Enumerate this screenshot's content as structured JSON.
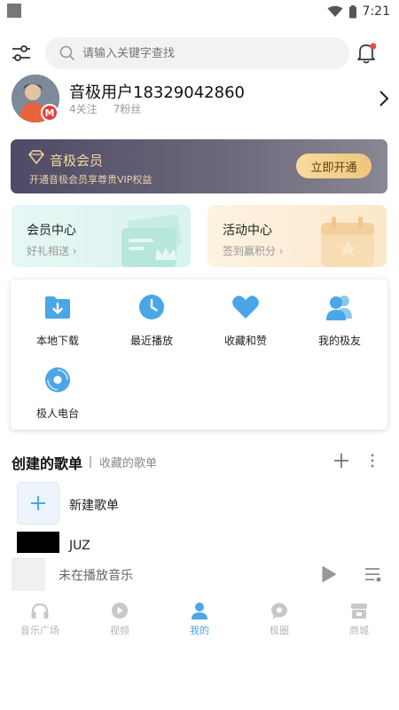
{
  "status_bar": {
    "time": "7:21"
  },
  "search": {
    "placeholder": "请输入关键字查找"
  },
  "profile": {
    "username": "音极用户18329042860",
    "following": "4关注",
    "followers": "7粉丝",
    "badge": "M"
  },
  "vip": {
    "title": "音极会员",
    "subtitle": "开通音极会员享尊贵VIP权益",
    "button": "立即开通"
  },
  "cards": [
    {
      "title": "会员中心",
      "subtitle": "好礼相送 ›"
    },
    {
      "title": "活动中心",
      "subtitle": "签到赢积分 ›"
    }
  ],
  "shortcuts": [
    {
      "label": "本地下载",
      "icon": "download-folder-icon"
    },
    {
      "label": "最近播放",
      "icon": "clock-icon"
    },
    {
      "label": "收藏和赞",
      "icon": "heart-icon"
    },
    {
      "label": "我的极友",
      "icon": "friends-icon"
    },
    {
      "label": "极人电台",
      "icon": "radio-disc-icon"
    }
  ],
  "playlists": {
    "title": "创建的歌单",
    "tab_collected": "收藏的歌单",
    "items": [
      {
        "label": "新建歌单"
      },
      {
        "label": "JUZ"
      }
    ]
  },
  "player": {
    "text": "未在播放音乐"
  },
  "tabs": [
    {
      "label": "音乐广场",
      "icon": "headphones-icon"
    },
    {
      "label": "视频",
      "icon": "video-play-icon"
    },
    {
      "label": "我的",
      "icon": "person-icon",
      "active": true
    },
    {
      "label": "极圈",
      "icon": "circle-chat-icon"
    },
    {
      "label": "商城",
      "icon": "shop-icon"
    }
  ],
  "colors": {
    "accent": "#4aa6e6",
    "vip_gold": "#f5d79a",
    "notify_dot": "#f04848"
  }
}
